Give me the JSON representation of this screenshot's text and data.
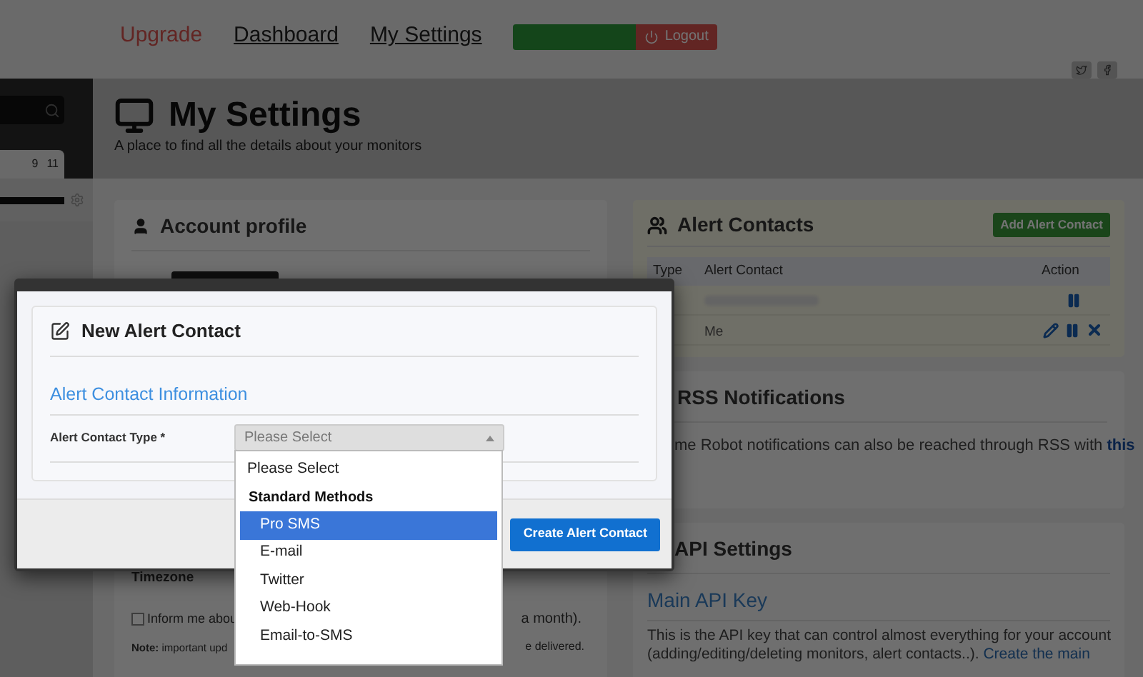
{
  "nav": {
    "links": [
      {
        "label": "Upgrade",
        "kind": "upgrade"
      },
      {
        "label": "Dashboard",
        "kind": "link"
      },
      {
        "label": "My Settings",
        "kind": "link"
      }
    ],
    "logout": "Logout"
  },
  "sidebar": {
    "calendar_days": [
      "9",
      "11"
    ]
  },
  "header": {
    "title": "My Settings",
    "subtitle": "A place to find all the details about your monitors"
  },
  "account_profile": {
    "title": "Account profile",
    "timezone_label": "Timezone",
    "newsletter_checked": false,
    "newsletter_start": "Inform me abou",
    "newsletter_end": "a month).",
    "note_start": "**Note:** important upd",
    "note_end": "e delivered."
  },
  "alert_contacts": {
    "title": "Alert Contacts",
    "add_button": "Add Alert Contact",
    "columns": [
      "Type",
      "Alert Contact",
      "Action"
    ],
    "rows": [
      {
        "kind": "hidden",
        "editable": false
      },
      {
        "kind": "text",
        "contact": "Me",
        "editable": true
      }
    ]
  },
  "rss": {
    "title": "RSS Notifications",
    "text": "me Robot notifications can also be reached through RSS with",
    "link": "this"
  },
  "api": {
    "title": "API Settings",
    "subtitle": "Main API Key",
    "line1": "This is the API key that can control almost everything for your account",
    "line2": "(adding/editing/deleting monitors, alert contacts..).",
    "link": "Create the main"
  },
  "modal": {
    "title": "New Alert Contact",
    "section": "Alert Contact Information",
    "field_label": "Alert Contact Type *",
    "select_value": "Please Select",
    "submit": "Create Alert Contact"
  },
  "dropdown": {
    "options": [
      {
        "label": "Please Select",
        "kind": "option",
        "selected": false
      },
      {
        "label": "Standard Methods",
        "kind": "group"
      },
      {
        "label": "Pro SMS",
        "kind": "option",
        "selected": true
      },
      {
        "label": "E-mail",
        "kind": "option",
        "selected": false
      },
      {
        "label": "Twitter",
        "kind": "option",
        "selected": false
      },
      {
        "label": "Web-Hook",
        "kind": "option",
        "selected": false
      },
      {
        "label": "Email-to-SMS",
        "kind": "option",
        "selected": false
      }
    ]
  }
}
